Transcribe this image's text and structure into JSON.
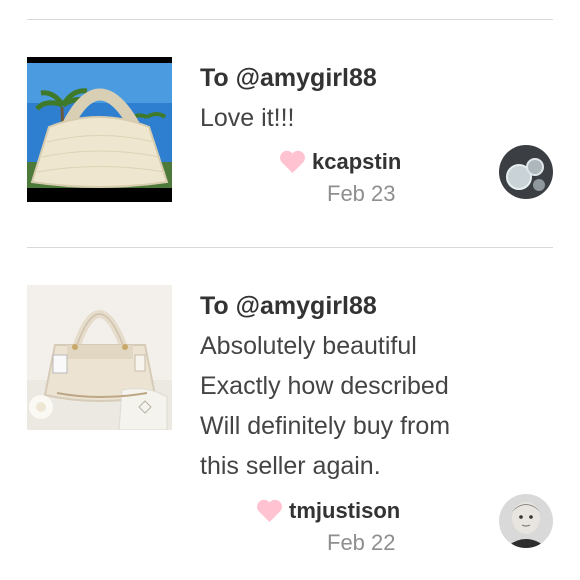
{
  "reviews": [
    {
      "to": "To @amygirl88",
      "message": "Love it!!!",
      "username": "kcapstin",
      "date": "Feb 23",
      "thumb_icon": "hobo-handbag-photo",
      "avatar_icon": "user-avatar-photo"
    },
    {
      "to": "To @amygirl88",
      "message": "Absolutely beautiful\nExactly how described\nWill definitely buy from\nthis seller again.",
      "username": "tmjustison",
      "date": "Feb 22",
      "thumb_icon": "satchel-handbag-photo",
      "avatar_icon": "user-avatar-photo"
    }
  ],
  "colors": {
    "heart": "#ffc2d0",
    "divider": "#d9d9d9",
    "date": "#8e8e8e"
  }
}
